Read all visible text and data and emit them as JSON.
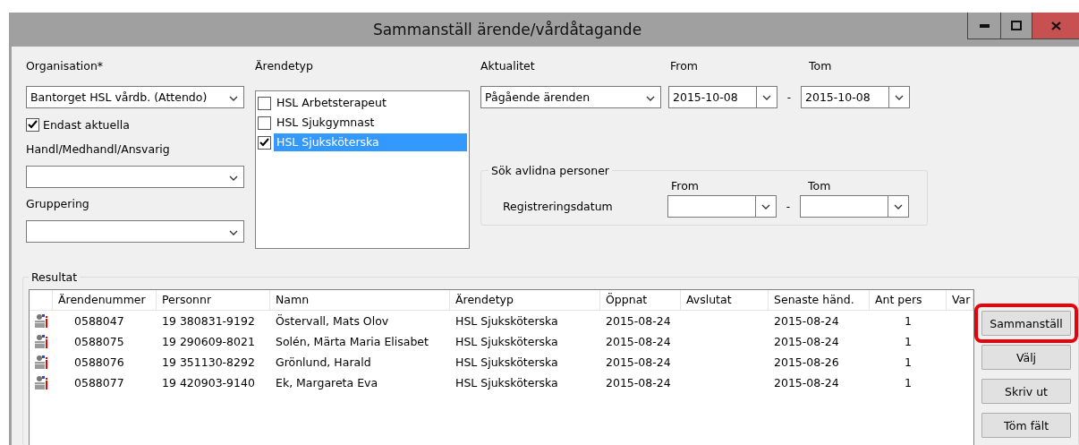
{
  "window": {
    "title": "Sammanställ ärende/vårdåtagande"
  },
  "organisation": {
    "label": "Organisation*",
    "value": "Bantorget HSL vårdb. (Attendo)"
  },
  "only_current": {
    "label": "Endast aktuella",
    "checked": true
  },
  "handler": {
    "label": "Handl/Medhandl/Ansvarig"
  },
  "grouping": {
    "label": "Gruppering"
  },
  "case_type": {
    "label": "Ärendetyp",
    "items": [
      {
        "label": "HSL Arbetsterapeut",
        "checked": false,
        "selected": false
      },
      {
        "label": "HSL Sjukgymnast",
        "checked": false,
        "selected": false
      },
      {
        "label": "HSL Sjuksköterska",
        "checked": true,
        "selected": true
      }
    ]
  },
  "currency": {
    "label": "Aktualitet",
    "value": "Pågående ärenden"
  },
  "from": {
    "label": "From",
    "value": "2015-10-08"
  },
  "dash": "-",
  "to": {
    "label": "Tom",
    "value": "2015-10-08"
  },
  "deceased": {
    "title": "Sök avlidna personer",
    "row_label": "Registreringsdatum",
    "from_label": "From",
    "to_label": "Tom",
    "dash": "-"
  },
  "results": {
    "title": "Resultat",
    "columns": [
      "Ärendenummer",
      "Personnr",
      "Namn",
      "Ärendetyp",
      "Öppnat",
      "Avslutat",
      "Senaste händ.",
      "Ant pers",
      "Var"
    ],
    "rows": [
      [
        "0588047",
        "19 380831-9192",
        "Östervall, Mats Olov",
        "HSL Sjuksköterska",
        "2015-08-24",
        "",
        "2015-08-24",
        "1",
        ""
      ],
      [
        "0588075",
        "19 290609-8021",
        "Solén, Märta Maria Elisabet",
        "HSL Sjuksköterska",
        "2015-08-24",
        "",
        "2015-08-24",
        "1",
        ""
      ],
      [
        "0588076",
        "19 351130-8292",
        "Grönlund, Harald",
        "HSL Sjuksköterska",
        "2015-08-24",
        "",
        "2015-08-26",
        "1",
        ""
      ],
      [
        "0588077",
        "19 420903-9140",
        "Ek, Margareta Eva",
        "HSL Sjuksköterska",
        "2015-08-24",
        "",
        "2015-08-24",
        "1",
        ""
      ]
    ]
  },
  "buttons": [
    {
      "label": "Sammanställ",
      "highlighted": true
    },
    {
      "label": "Välj",
      "highlighted": false
    },
    {
      "label": "Skriv ut",
      "highlighted": false
    },
    {
      "label": "Töm fält",
      "highlighted": false
    }
  ]
}
